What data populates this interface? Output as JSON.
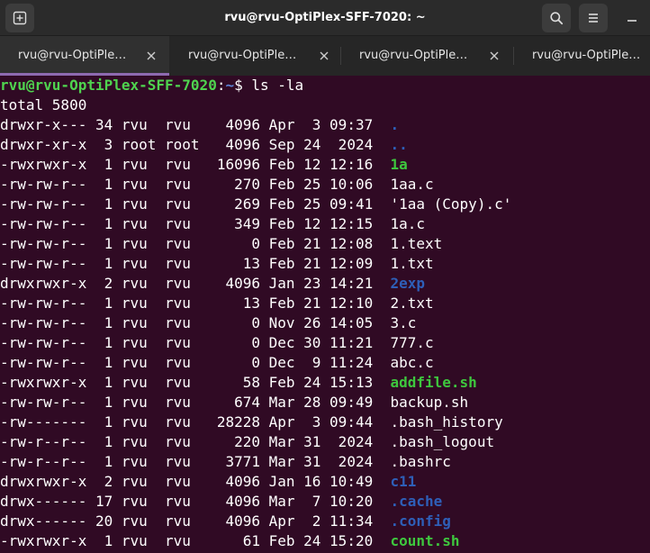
{
  "window": {
    "title": "rvu@rvu-OptiPlex-SFF-7020: ~",
    "colors": {
      "background": "#300a24",
      "header": "#2b2b2b",
      "tab_indicator": "#8e6ab0",
      "prompt_user": "#4fd34f",
      "directory": "#2e5fb8",
      "executable": "#3ec73e"
    }
  },
  "tabs": [
    {
      "label": "rvu@rvu-OptiPle…",
      "active": true
    },
    {
      "label": "rvu@rvu-OptiPle…",
      "active": false
    },
    {
      "label": "rvu@rvu-OptiPle…",
      "active": false
    },
    {
      "label": "rvu@rvu-OptiPle…",
      "active": false
    }
  ],
  "terminal": {
    "prompt": {
      "user_host": "rvu@rvu-OptiPlex-SFF-7020",
      "separator": ":",
      "path": "~",
      "symbol": "$",
      "command": "ls -la"
    },
    "total_line": "total 5800",
    "listing": [
      {
        "perms": "drwxr-x---",
        "links": "34",
        "owner": "rvu",
        "group": "rvu",
        "size": "4096",
        "month": "Apr",
        "day": "3",
        "time": "09:37",
        "name": ".",
        "kind": "dir"
      },
      {
        "perms": "drwxr-xr-x",
        "links": "3",
        "owner": "root",
        "group": "root",
        "size": "4096",
        "month": "Sep",
        "day": "24",
        "time": "2024",
        "name": "..",
        "kind": "dir"
      },
      {
        "perms": "-rwxrwxr-x",
        "links": "1",
        "owner": "rvu",
        "group": "rvu",
        "size": "16096",
        "month": "Feb",
        "day": "12",
        "time": "12:16",
        "name": "1a",
        "kind": "exec"
      },
      {
        "perms": "-rw-rw-r--",
        "links": "1",
        "owner": "rvu",
        "group": "rvu",
        "size": "270",
        "month": "Feb",
        "day": "25",
        "time": "10:06",
        "name": "1aa.c",
        "kind": "file"
      },
      {
        "perms": "-rw-rw-r--",
        "links": "1",
        "owner": "rvu",
        "group": "rvu",
        "size": "269",
        "month": "Feb",
        "day": "25",
        "time": "09:41",
        "name": "'1aa (Copy).c'",
        "kind": "file"
      },
      {
        "perms": "-rw-rw-r--",
        "links": "1",
        "owner": "rvu",
        "group": "rvu",
        "size": "349",
        "month": "Feb",
        "day": "12",
        "time": "12:15",
        "name": "1a.c",
        "kind": "file"
      },
      {
        "perms": "-rw-rw-r--",
        "links": "1",
        "owner": "rvu",
        "group": "rvu",
        "size": "0",
        "month": "Feb",
        "day": "21",
        "time": "12:08",
        "name": "1.text",
        "kind": "file"
      },
      {
        "perms": "-rw-rw-r--",
        "links": "1",
        "owner": "rvu",
        "group": "rvu",
        "size": "13",
        "month": "Feb",
        "day": "21",
        "time": "12:09",
        "name": "1.txt",
        "kind": "file"
      },
      {
        "perms": "drwxrwxr-x",
        "links": "2",
        "owner": "rvu",
        "group": "rvu",
        "size": "4096",
        "month": "Jan",
        "day": "23",
        "time": "14:21",
        "name": "2exp",
        "kind": "dir"
      },
      {
        "perms": "-rw-rw-r--",
        "links": "1",
        "owner": "rvu",
        "group": "rvu",
        "size": "13",
        "month": "Feb",
        "day": "21",
        "time": "12:10",
        "name": "2.txt",
        "kind": "file"
      },
      {
        "perms": "-rw-rw-r--",
        "links": "1",
        "owner": "rvu",
        "group": "rvu",
        "size": "0",
        "month": "Nov",
        "day": "26",
        "time": "14:05",
        "name": "3.c",
        "kind": "file"
      },
      {
        "perms": "-rw-rw-r--",
        "links": "1",
        "owner": "rvu",
        "group": "rvu",
        "size": "0",
        "month": "Dec",
        "day": "30",
        "time": "11:21",
        "name": "777.c",
        "kind": "file"
      },
      {
        "perms": "-rw-rw-r--",
        "links": "1",
        "owner": "rvu",
        "group": "rvu",
        "size": "0",
        "month": "Dec",
        "day": "9",
        "time": "11:24",
        "name": "abc.c",
        "kind": "file"
      },
      {
        "perms": "-rwxrwxr-x",
        "links": "1",
        "owner": "rvu",
        "group": "rvu",
        "size": "58",
        "month": "Feb",
        "day": "24",
        "time": "15:13",
        "name": "addfile.sh",
        "kind": "exec"
      },
      {
        "perms": "-rw-rw-r--",
        "links": "1",
        "owner": "rvu",
        "group": "rvu",
        "size": "674",
        "month": "Mar",
        "day": "28",
        "time": "09:49",
        "name": "backup.sh",
        "kind": "file"
      },
      {
        "perms": "-rw-------",
        "links": "1",
        "owner": "rvu",
        "group": "rvu",
        "size": "28228",
        "month": "Apr",
        "day": "3",
        "time": "09:44",
        "name": ".bash_history",
        "kind": "file"
      },
      {
        "perms": "-rw-r--r--",
        "links": "1",
        "owner": "rvu",
        "group": "rvu",
        "size": "220",
        "month": "Mar",
        "day": "31",
        "time": "2024",
        "name": ".bash_logout",
        "kind": "file"
      },
      {
        "perms": "-rw-r--r--",
        "links": "1",
        "owner": "rvu",
        "group": "rvu",
        "size": "3771",
        "month": "Mar",
        "day": "31",
        "time": "2024",
        "name": ".bashrc",
        "kind": "file"
      },
      {
        "perms": "drwxrwxr-x",
        "links": "2",
        "owner": "rvu",
        "group": "rvu",
        "size": "4096",
        "month": "Jan",
        "day": "16",
        "time": "10:49",
        "name": "c11",
        "kind": "dir"
      },
      {
        "perms": "drwx------",
        "links": "17",
        "owner": "rvu",
        "group": "rvu",
        "size": "4096",
        "month": "Mar",
        "day": "7",
        "time": "10:20",
        "name": ".cache",
        "kind": "dir"
      },
      {
        "perms": "drwx------",
        "links": "20",
        "owner": "rvu",
        "group": "rvu",
        "size": "4096",
        "month": "Apr",
        "day": "2",
        "time": "11:34",
        "name": ".config",
        "kind": "dir"
      },
      {
        "perms": "-rwxrwxr-x",
        "links": "1",
        "owner": "rvu",
        "group": "rvu",
        "size": "61",
        "month": "Feb",
        "day": "24",
        "time": "15:20",
        "name": "count.sh",
        "kind": "exec"
      }
    ]
  }
}
